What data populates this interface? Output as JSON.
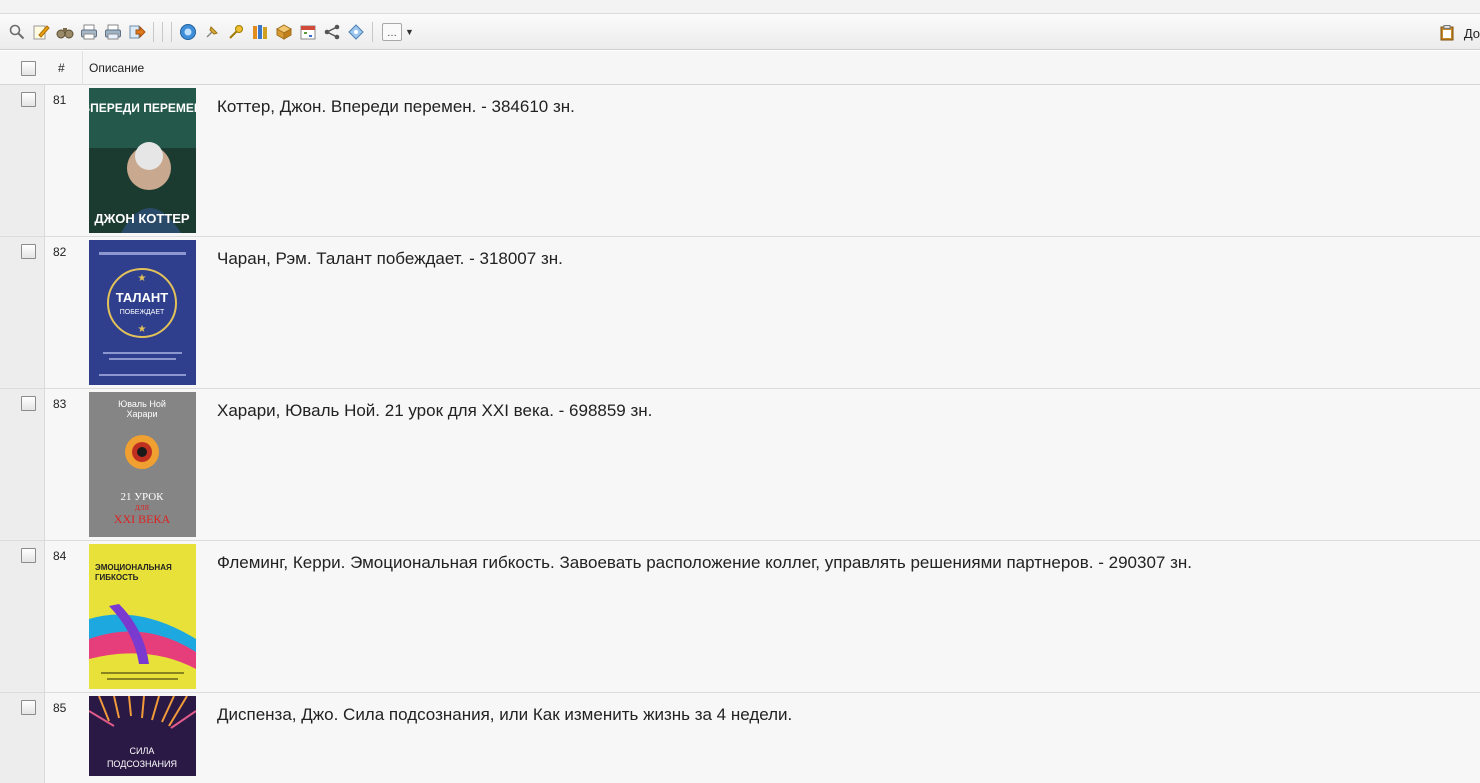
{
  "toolbar": {
    "icons": [
      "search-icon",
      "edit-icon",
      "binoculars-icon",
      "print-icon",
      "print-preview-icon",
      "export-icon",
      "info-icon",
      "pin-icon",
      "key-icon",
      "books-icon",
      "cube-icon",
      "calendar-icon",
      "share-icon",
      "tag-icon"
    ],
    "more_label": "…",
    "right_label": "До"
  },
  "table": {
    "columns": {
      "number": "#",
      "description": "Описание"
    },
    "rows": [
      {
        "num": "81",
        "description": "Коттер, Джон. Впереди перемен. - 384610 зн.",
        "cover": {
          "top_text": "ВПЕРЕДИ ПЕРЕМЕН",
          "bottom_text": "ДЖОН КОТТЕР",
          "bg": "#1f4f3f"
        }
      },
      {
        "num": "82",
        "description": "Чаран, Рэм. Талант побеждает. - 318007 зн.",
        "cover": {
          "line1": "ТАЛАНТ",
          "line2": "ПОБЕЖДАЕТ",
          "bg": "#2e3f8f"
        }
      },
      {
        "num": "83",
        "description": "Харари, Юваль Ной. 21 урок для XXI века. - 698859 зн.",
        "cover": {
          "line1": "Юваль Ной",
          "line2": "Харари",
          "line3": "21 УРОК",
          "line4": "ДЛЯ",
          "line5": "XXI ВЕКА",
          "bg": "#8a8a8a"
        }
      },
      {
        "num": "84",
        "description": "Флеминг, Керри. Эмоциональная гибкость. Завоевать расположение коллег, управлять решениями партнеров. - 290307 зн.",
        "cover": {
          "line1": "ЭМОЦИОНАЛЬНАЯ",
          "line2": "ГИБКОСТЬ",
          "bg": "#e9e23a"
        }
      },
      {
        "num": "85",
        "description": "Диспенза, Джо. Сила подсознания, или Как изменить жизнь за 4 недели.",
        "cover": {
          "line1": "СИЛА",
          "line2": "ПОДСОЗНАНИЯ",
          "bg": "#2b1a4a"
        }
      }
    ]
  }
}
